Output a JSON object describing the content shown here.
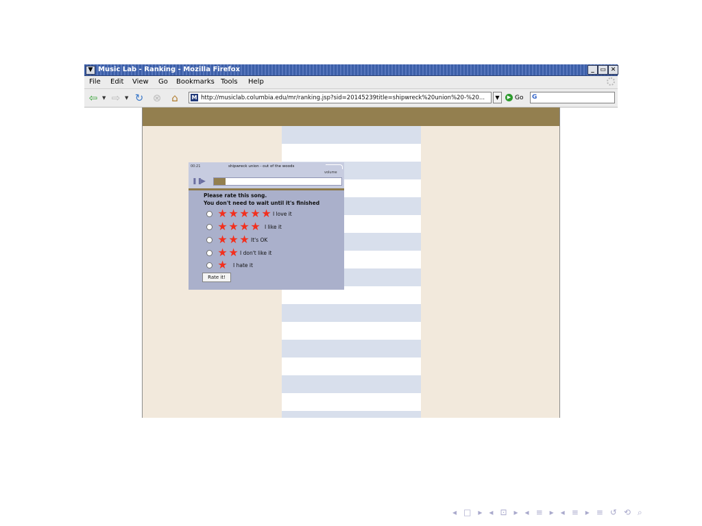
{
  "window": {
    "title": "Music Lab - Ranking - Mozilla Firefox",
    "controls": {
      "minimize": "_",
      "maximize": "▭",
      "close": "✕"
    }
  },
  "menubar": {
    "items": [
      {
        "label": "File"
      },
      {
        "label": "Edit"
      },
      {
        "label": "View"
      },
      {
        "label": "Go"
      },
      {
        "label": "Bookmarks"
      },
      {
        "label": "Tools"
      },
      {
        "label": "Help"
      }
    ]
  },
  "navbar": {
    "url": "http://musiclab.columbia.edu/mr/ranking.jsp?sid=20145239title=shipwreck%20union%20-%20...",
    "go_label": "Go",
    "icons": [
      "back-icon",
      "forward-icon",
      "reload-icon",
      "stop-icon",
      "home-icon"
    ]
  },
  "player": {
    "time": "00:21",
    "song_title": "shipwreck union - out of the woods",
    "volume_label": "volume",
    "progress": 0.09
  },
  "rating": {
    "prompt_line1": "Please rate this song.",
    "prompt_line2": "You don't need to wait until it's finished",
    "options": [
      {
        "stars": 5,
        "label": "I love it"
      },
      {
        "stars": 4,
        "label": "I like it"
      },
      {
        "stars": 3,
        "label": "It's OK"
      },
      {
        "stars": 2,
        "label": "I don't like it"
      },
      {
        "stars": 1,
        "label": "I hate it"
      }
    ],
    "button_label": "Rate it!"
  },
  "colors": {
    "page_background": "#f2e9dc",
    "band": "#937f4f",
    "stripe": "#d8dfec",
    "panel": "#aab0cb",
    "star": "#f2301e"
  },
  "beamer_nav": [
    "◂",
    "□",
    "▸",
    "◂",
    "⊡",
    "▸",
    "◂",
    "≡",
    "▸",
    "◂",
    "≡",
    "▸",
    "≡",
    "↺",
    "⟲",
    "⌕"
  ]
}
